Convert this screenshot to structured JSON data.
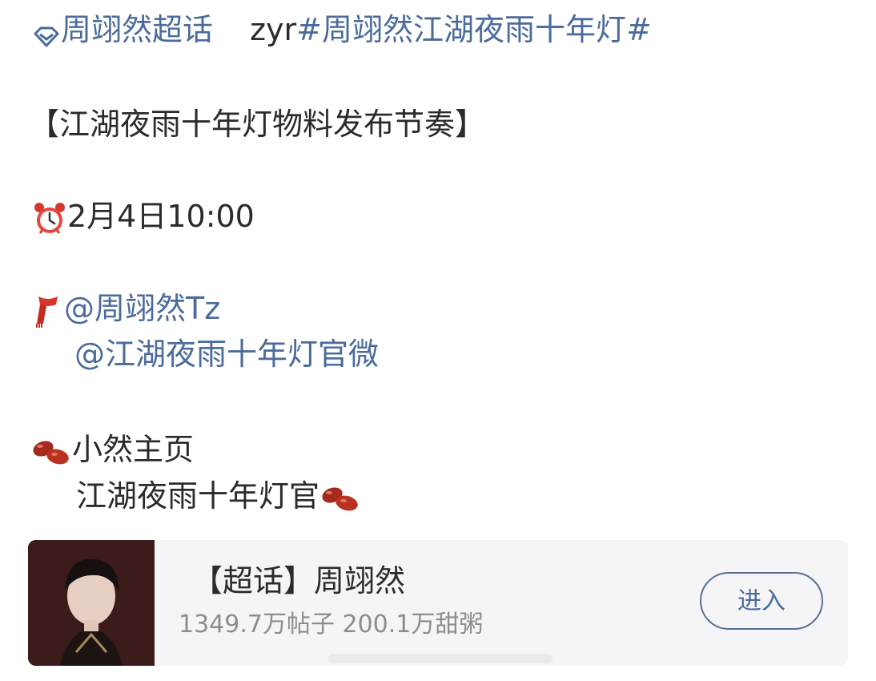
{
  "post": {
    "supertopic_label": "周翊然超话",
    "author_prefix": "zyr",
    "hashtag": "#周翊然江湖夜雨十年灯#",
    "headline": "【江湖夜雨十年灯物料发布节奏】",
    "time_text": "2月4日10:00",
    "mention_1": "@周翊然Tz",
    "mention_2": "@江湖夜雨十年灯官微",
    "line_homepage": "小然主页",
    "line_official": "江湖夜雨十年灯官"
  },
  "card": {
    "title": "【超话】周翊然",
    "stats": "1349.7万帖子 200.1万甜粥",
    "enter_label": "进入"
  },
  "colors": {
    "link": "#4a6b9c",
    "text": "#2b2b2b",
    "muted": "#8d8d8d",
    "card_bg": "#f5f5f7"
  },
  "icons": [
    "diamond-icon",
    "alarm-clock-icon",
    "scarf-icon",
    "bean-icon"
  ]
}
